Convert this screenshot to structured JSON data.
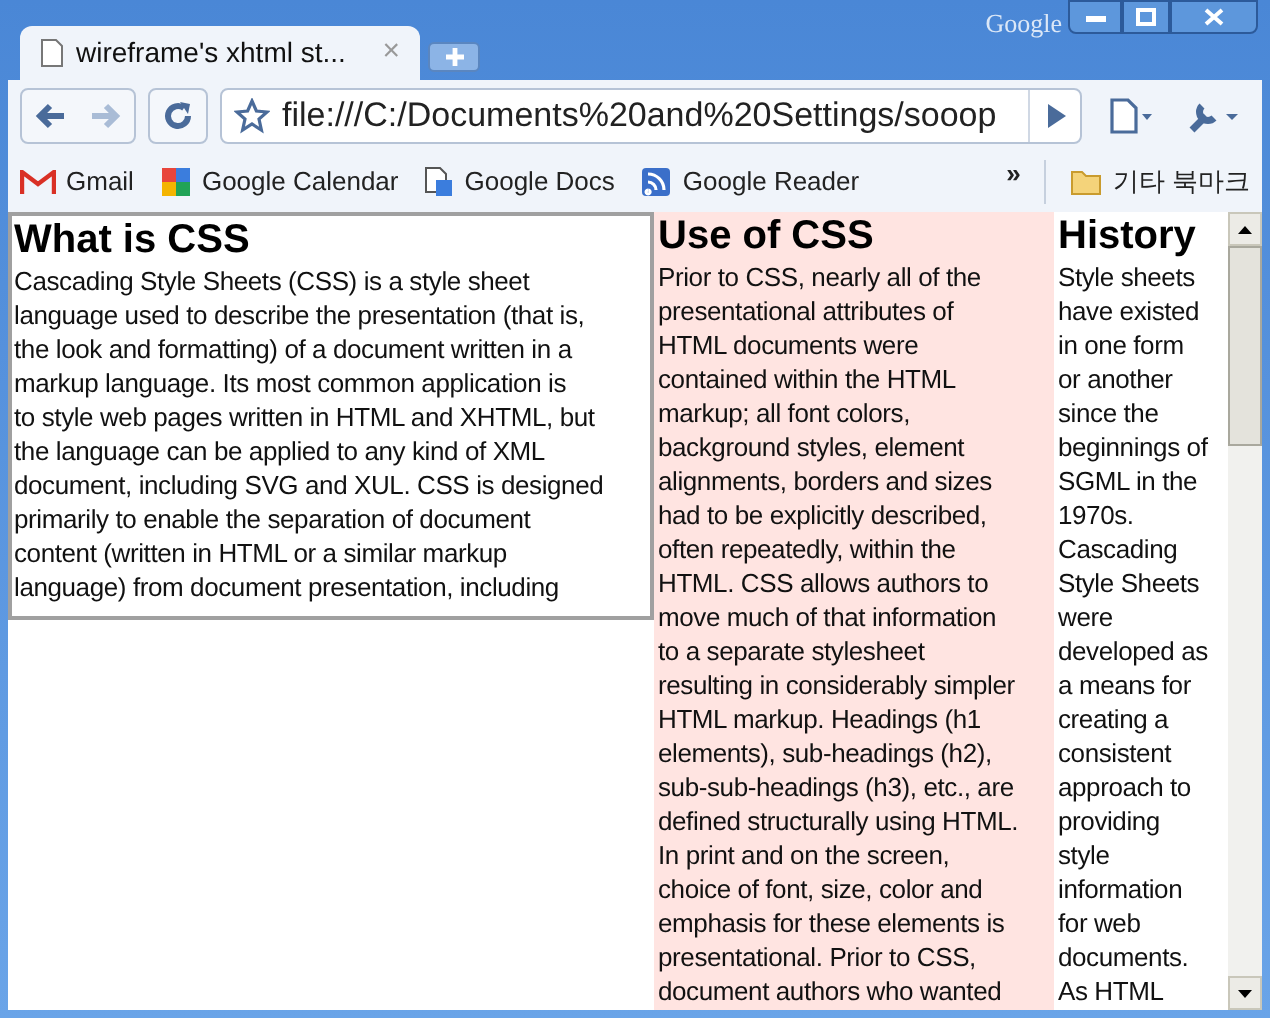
{
  "window": {
    "brand": "Google"
  },
  "tabs": [
    {
      "label": "wireframe's xhtml st...",
      "close": "×",
      "selected": true
    }
  ],
  "address_bar": {
    "value": "file:///C:/Documents%20and%20Settings/sooop"
  },
  "bookmarks": [
    {
      "label": "Gmail",
      "kind": "mail"
    },
    {
      "label": "Google Calendar",
      "kind": "calendar"
    },
    {
      "label": "Google Docs",
      "kind": "docs"
    },
    {
      "label": "Google Reader",
      "kind": "reader"
    }
  ],
  "bookmarks_overflow": "»",
  "other_bookmarks": "기타 북마크",
  "columns": [
    {
      "kind": "boxed",
      "color": "#ffffff",
      "heading": "What is CSS",
      "lines": [
        "Cascading Style Sheets (CSS) is a style sheet",
        "language used to describe the presentation (that is,",
        "the look and formatting) of a document written in a",
        "markup language. Its most common application is",
        "to style web pages written in HTML and XHTML, but",
        "the language can be applied to any kind of XML",
        "document, including SVG and XUL. CSS is designed",
        "primarily to enable the separation of document",
        "content (written in HTML or a similar markup",
        "language) from document presentation, including"
      ]
    },
    {
      "kind": "plain",
      "color": "#ffe4e1",
      "heading": "Use of CSS",
      "lines": [
        "Prior to CSS, nearly all of the",
        "presentational attributes of",
        "HTML documents were",
        "contained within the HTML",
        "markup; all font colors,",
        "background styles, element",
        "alignments, borders and sizes",
        "had to be explicitly described,",
        "often repeatedly, within the",
        "HTML. CSS allows authors to",
        "move much of that information",
        "to a separate stylesheet",
        "resulting in considerably simpler",
        "HTML markup. Headings (h1",
        "elements), sub-headings (h2),",
        "sub-sub-headings (h3), etc., are",
        "defined structurally using HTML.",
        "In print and on the screen,",
        "choice of font, size, color and",
        "emphasis for these elements is",
        "presentational. Prior to CSS,",
        "document authors who wanted"
      ]
    },
    {
      "kind": "plain",
      "color": "#ffffff",
      "heading": "History",
      "lines": [
        "Style sheets",
        "have existed",
        "in one form",
        "or another",
        "since the",
        "beginnings of",
        "SGML in the",
        "1970s.",
        "Cascading",
        "Style Sheets",
        "were",
        "developed as",
        "a means for",
        "creating a",
        "consistent",
        "approach to",
        "providing",
        "style",
        "information",
        "for web",
        "documents.",
        "As HTML"
      ]
    }
  ]
}
